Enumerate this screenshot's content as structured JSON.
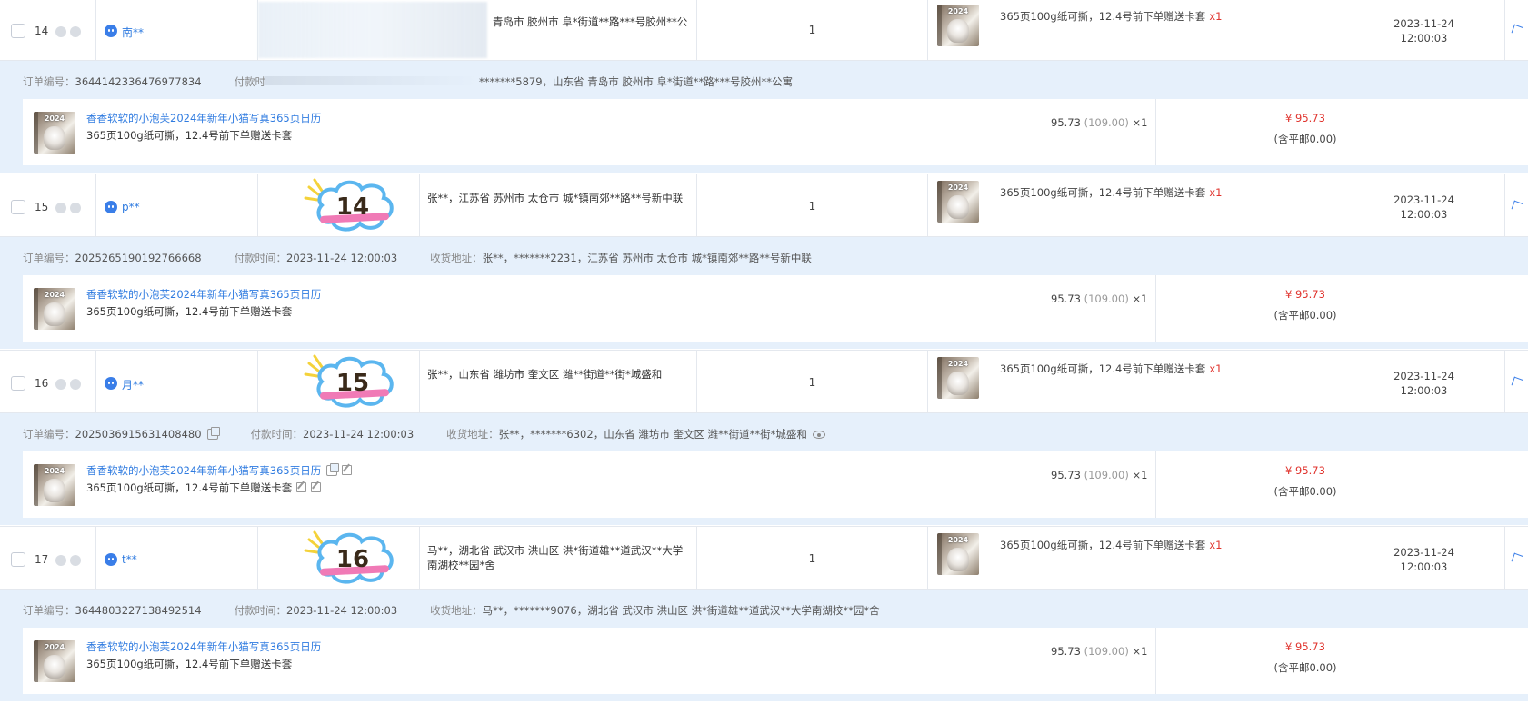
{
  "product": {
    "title": "香香软软的小泡芙2024年新年小猫写真365页日历",
    "variant": "365页100g纸可撕，12.4号前下单赠送卡套",
    "thumb_year": "2024",
    "unit_price": "95.73",
    "orig_price": "(109.00)",
    "qty_mult": "×1",
    "total": "¥ 95.73",
    "shipping": "(含平邮0.00)",
    "variant_mult": "x1"
  },
  "labels": {
    "order_no": "订单编号：",
    "pay_time": "付款时间：",
    "addr": "收货地址："
  },
  "orders": [
    {
      "index": "14",
      "buyer": "南**",
      "sticker": "",
      "address": "青岛市 胶州市 阜*街道**路***号胶州**公",
      "qty": "1",
      "date": "2023-11-24",
      "time": "12:00:03",
      "order_no": "3644142336476977834",
      "pay_time_label": "付款时",
      "pay_time": "",
      "addr_label": "",
      "full_addr": "*******5879，山东省 青岛市 胶州市 阜*街道**路***号胶州**公寓"
    },
    {
      "index": "15",
      "buyer": "p**",
      "sticker": "14",
      "address": "张**，江苏省 苏州市 太仓市 城*镇南郊**路**号新中联",
      "qty": "1",
      "date": "2023-11-24",
      "time": "12:00:03",
      "order_no": "2025265190192766668",
      "pay_time_label": "付款时间：",
      "pay_time": "2023-11-24 12:00:03",
      "addr_label": "收货地址：",
      "full_addr": "张**，*******2231，江苏省 苏州市 太仓市 城*镇南郊**路**号新中联"
    },
    {
      "index": "16",
      "buyer": "月**",
      "sticker": "15",
      "address": "张**，山东省 潍坊市 奎文区 潍**街道**街*城盛和",
      "qty": "1",
      "date": "2023-11-24",
      "time": "12:00:03",
      "order_no": "2025036915631408480",
      "pay_time_label": "付款时间：",
      "pay_time": "2023-11-24 12:00:03",
      "addr_label": "收货地址：",
      "full_addr": "张**，*******6302，山东省 潍坊市 奎文区 潍**街道**街*城盛和"
    },
    {
      "index": "17",
      "buyer": "t**",
      "sticker": "16",
      "address": "马**，湖北省 武汉市 洪山区 洪*街道雄**道武汉**大学南湖校**园*舍",
      "qty": "1",
      "date": "2023-11-24",
      "time": "12:00:03",
      "order_no": "3644803227138492514",
      "pay_time_label": "付款时间：",
      "pay_time": "2023-11-24 12:00:03",
      "addr_label": "收货地址：",
      "full_addr": "马**，*******9076，湖北省 武汉市 洪山区 洪*街道雄**道武汉**大学南湖校**园*舍"
    }
  ],
  "colors": {
    "accent": "#2f7be0",
    "price_red": "#e0332d",
    "info_bg": "#e6f0fb",
    "sticker_blue": "#5bb6ef",
    "sticker_pink": "#f07ab6",
    "sticker_ray": "#f4d23a"
  }
}
